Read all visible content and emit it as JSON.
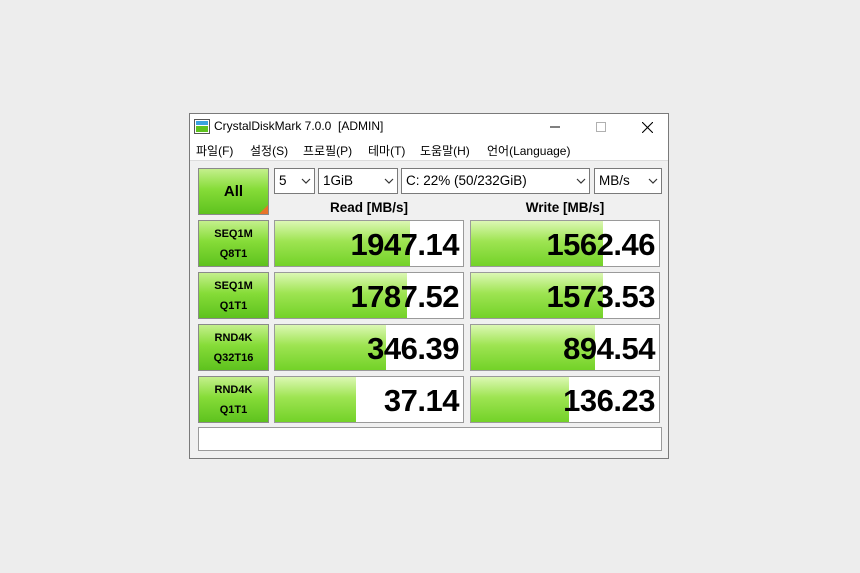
{
  "window": {
    "title": "CrystalDiskMark 7.0.0  [ADMIN]"
  },
  "menu": [
    {
      "label": "파일(F)"
    },
    {
      "label": "설정(S)"
    },
    {
      "label": "프로필(P)"
    },
    {
      "label": "테마(T)"
    },
    {
      "label": "도움말(H)"
    },
    {
      "label": "언어(Language)"
    }
  ],
  "controls": {
    "all_label": "All",
    "count_value": "5",
    "size_value": "1GiB",
    "drive_value": "C: 22% (50/232GiB)",
    "unit_value": "MB/s"
  },
  "headers": {
    "read": "Read [MB/s]",
    "write": "Write [MB/s]"
  },
  "tests": [
    {
      "line1": "SEQ1M",
      "line2": "Q8T1",
      "read": "1947.14",
      "write": "1562.46",
      "read_fill": 0.72,
      "write_fill": 0.7
    },
    {
      "line1": "SEQ1M",
      "line2": "Q1T1",
      "read": "1787.52",
      "write": "1573.53",
      "read_fill": 0.7,
      "write_fill": 0.7
    },
    {
      "line1": "RND4K",
      "line2": "Q32T16",
      "read": "346.39",
      "write": "894.54",
      "read_fill": 0.59,
      "write_fill": 0.66
    },
    {
      "line1": "RND4K",
      "line2": "Q1T1",
      "read": "37.14",
      "write": "136.23",
      "read_fill": 0.43,
      "write_fill": 0.52
    }
  ],
  "comment": "",
  "colors": {
    "accent_green": "#86dc38",
    "corner_orange": "#e8742a"
  }
}
